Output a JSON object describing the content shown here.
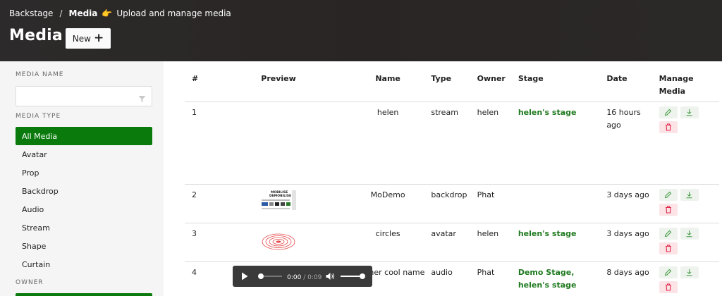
{
  "breadcrumb": {
    "root": "Backstage",
    "separator": "/",
    "current": "Media",
    "description": "Upload and manage media",
    "hand_icon": "pointing-hand-icon"
  },
  "page": {
    "title": "Media",
    "new_button": "New"
  },
  "sidebar": {
    "media_name_label": "MEDIA NAME",
    "media_name_value": "",
    "media_type_label": "MEDIA TYPE",
    "types": [
      {
        "label": "All Media",
        "active": true
      },
      {
        "label": "Avatar",
        "active": false
      },
      {
        "label": "Prop",
        "active": false
      },
      {
        "label": "Backdrop",
        "active": false
      },
      {
        "label": "Audio",
        "active": false
      },
      {
        "label": "Stream",
        "active": false
      },
      {
        "label": "Shape",
        "active": false
      },
      {
        "label": "Curtain",
        "active": false
      }
    ],
    "owner_label": "OWNER"
  },
  "table": {
    "headers": {
      "num": "#",
      "preview": "Preview",
      "name": "Name",
      "type": "Type",
      "owner": "Owner",
      "stage": "Stage",
      "date": "Date",
      "manage": "Manage Media"
    },
    "rows": [
      {
        "num": "1",
        "name": "helen",
        "type": "stream",
        "owner": "helen",
        "stage": "helen's stage",
        "date": "16 hours ago"
      },
      {
        "num": "2",
        "name": "MoDemo",
        "type": "backdrop",
        "owner": "Phat",
        "stage": "",
        "date": "3 days ago",
        "thumb_title": "MOBILISE DEMOBILISE"
      },
      {
        "num": "3",
        "name": "circles",
        "type": "avatar",
        "owner": "helen",
        "stage": "helen's stage",
        "date": "3 days ago"
      },
      {
        "num": "4",
        "name": "Another cool name",
        "type": "audio",
        "owner": "Phat",
        "stage": "Demo Stage, helen's stage",
        "date": "8 days ago",
        "audio": {
          "current": "0:00",
          "sep": " / ",
          "duration": "0:09"
        }
      }
    ]
  },
  "colors": {
    "accent": "#0a7a0d",
    "link": "#1f7a1f",
    "delete_bg": "#fbe3e6",
    "header_bg": "#2b2828"
  }
}
